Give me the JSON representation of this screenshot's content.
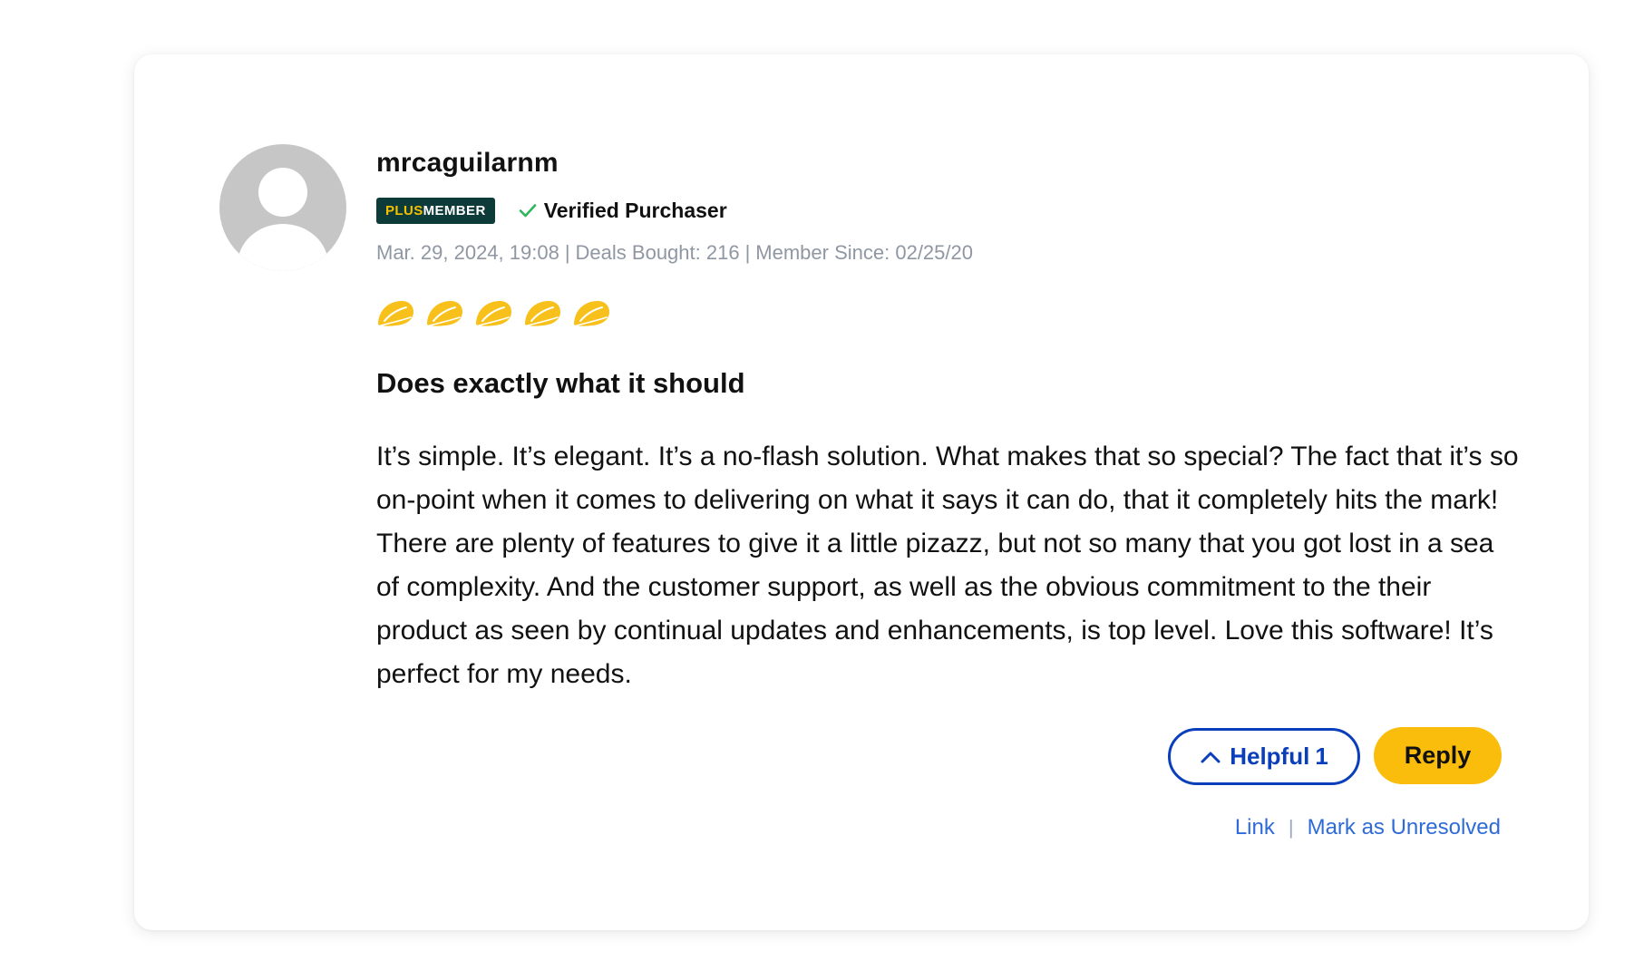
{
  "review": {
    "username": "mrcaguilarnm",
    "plus_badge": {
      "plus": "PLUS",
      "member": "MEMBER"
    },
    "verified_label": "Verified Purchaser",
    "meta": {
      "date": "Mar. 29, 2024, 19:08",
      "separator": "|",
      "deals_bought": "Deals Bought: 216",
      "member_since": "Member Since: 02/25/20"
    },
    "rating": 5,
    "rating_icon": "taco-icon",
    "title": "Does exactly what it should",
    "body": "It’s simple. It’s elegant. It’s a no-flash solution. What makes that so special? The fact that it’s so on-point when it comes to delivering on what it says it can do, that it completely hits the mark! There are plenty of features to give it a little pizazz, but not so many that you got lost in a sea of complexity. And the customer support, as well as the obvious commitment to the their product as seen by continual updates and enhancements, is top level. Love this software! It’s perfect for my needs."
  },
  "actions": {
    "helpful_label": "Helpful",
    "helpful_count": "1",
    "reply_label": "Reply",
    "link_label": "Link",
    "divider": "|",
    "mark_unresolved_label": "Mark as Unresolved"
  },
  "colors": {
    "accent_blue": "#0a3eba",
    "reply_yellow": "#fbbd0c",
    "badge_green": "#0c3b3a",
    "check_green": "#2fb55a",
    "link_blue": "#2f6bd7",
    "meta_gray": "#8f97a3",
    "taco_yellow": "#f8c01a"
  }
}
